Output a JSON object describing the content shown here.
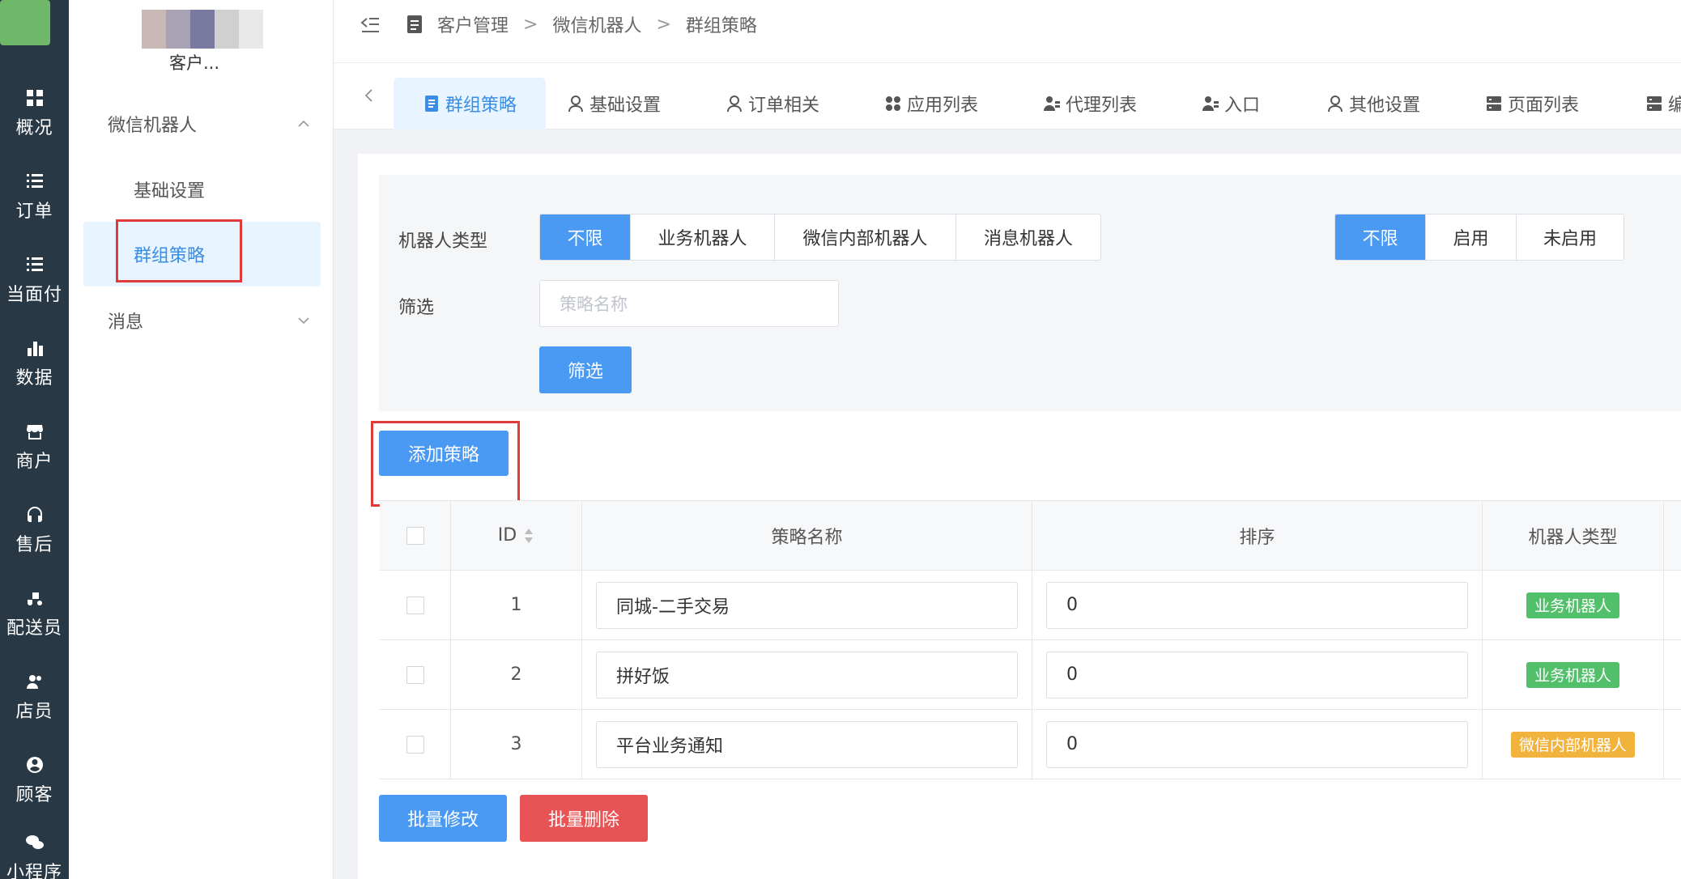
{
  "rail": {
    "items": [
      {
        "label": "概况",
        "icon": "dashboard-icon"
      },
      {
        "label": "订单",
        "icon": "list-icon"
      },
      {
        "label": "当面付",
        "icon": "list-icon"
      },
      {
        "label": "数据",
        "icon": "bar-chart-icon"
      },
      {
        "label": "商户",
        "icon": "store-icon"
      },
      {
        "label": "售后",
        "icon": "headset-icon"
      },
      {
        "label": "配送员",
        "icon": "delivery-icon"
      },
      {
        "label": "店员",
        "icon": "users-icon"
      },
      {
        "label": "顾客",
        "icon": "user-circle-icon"
      },
      {
        "label": "小程序",
        "icon": "wechat-icon"
      }
    ]
  },
  "subnav": {
    "shop_name": "客户...",
    "group1": "微信机器人",
    "item_basic": "基础设置",
    "item_active": "群组策略",
    "group2": "消息"
  },
  "breadcrumb": {
    "items": [
      "客户管理",
      "微信机器人",
      "群组策略"
    ],
    "sep": ">"
  },
  "tabs": [
    {
      "label": "群组策略",
      "icon": "document-icon",
      "active": true
    },
    {
      "label": "基础设置",
      "icon": "user-icon"
    },
    {
      "label": "订单相关",
      "icon": "user-icon"
    },
    {
      "label": "应用列表",
      "icon": "grid-icon"
    },
    {
      "label": "代理列表",
      "icon": "users-icon"
    },
    {
      "label": "入口",
      "icon": "users-icon"
    },
    {
      "label": "其他设置",
      "icon": "user-icon"
    },
    {
      "label": "页面列表",
      "icon": "server-icon"
    },
    {
      "label": "编",
      "icon": "server-icon"
    }
  ],
  "filter": {
    "robot_type_label": "机器人类型",
    "robot_type_options": [
      "不限",
      "业务机器人",
      "微信内部机器人",
      "消息机器人"
    ],
    "status_options": [
      "不限",
      "启用",
      "未启用"
    ],
    "filter_label": "筛选",
    "name_placeholder": "策略名称",
    "filter_button": "筛选"
  },
  "add_button": "添加策略",
  "table": {
    "headers": {
      "id": "ID",
      "name": "策略名称",
      "sort": "排序",
      "type": "机器人类型"
    },
    "rows": [
      {
        "id": "1",
        "name": "同城-二手交易",
        "sort": "0",
        "type": "业务机器人",
        "type_color": "#52bf6a"
      },
      {
        "id": "2",
        "name": "拼好饭",
        "sort": "0",
        "type": "业务机器人",
        "type_color": "#52bf6a"
      },
      {
        "id": "3",
        "name": "平台业务通知",
        "sort": "0",
        "type": "微信内部机器人",
        "type_color": "#f2b33d"
      }
    ]
  },
  "batch_edit": "批量修改",
  "batch_delete": "批量删除",
  "colors": {
    "accent": "#4a9af3",
    "danger": "#e85455",
    "rail_bg": "#283845",
    "highlight": "#e03b3b"
  }
}
